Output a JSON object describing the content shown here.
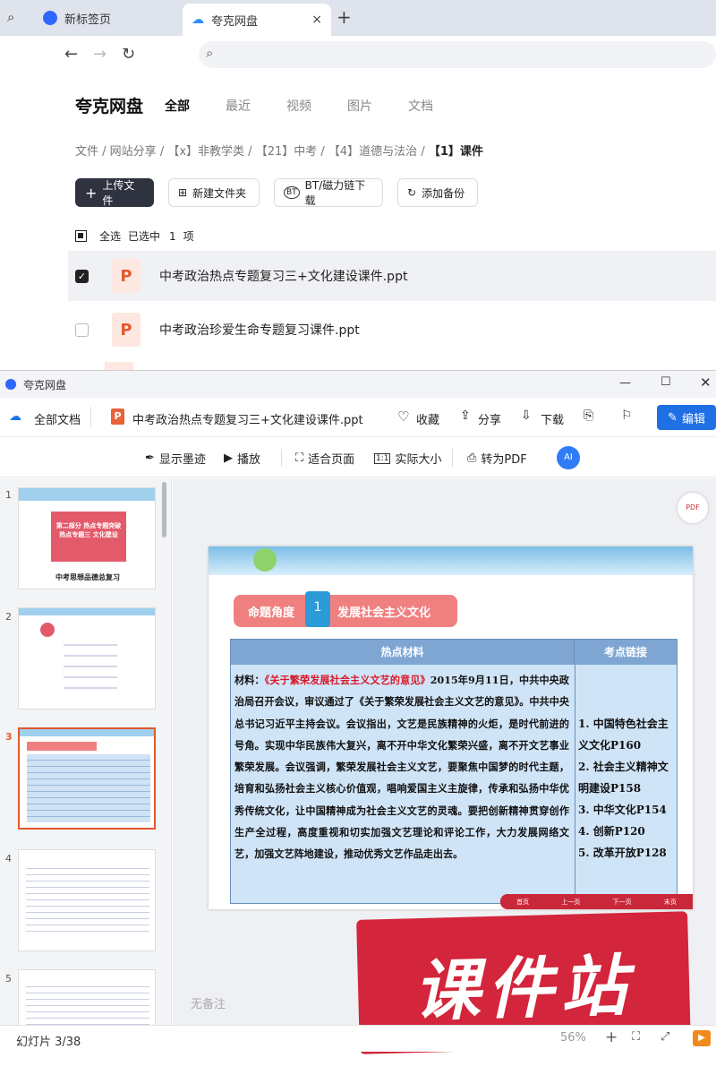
{
  "browser": {
    "tabs": [
      {
        "label": "新标签页"
      },
      {
        "label": "夸克网盘"
      }
    ],
    "new_tab": "+",
    "close": "×"
  },
  "pan": {
    "logo": "夸克网盘",
    "tabs": [
      "全部",
      "最近",
      "视频",
      "图片",
      "文档"
    ],
    "breadcrumb": [
      "文件",
      "网站分享",
      "【x】非教学类",
      "【21】中考",
      "【4】道德与法治",
      "【1】课件"
    ],
    "actions": {
      "upload": "上传文件",
      "new_folder": "新建文件夹",
      "bt": "BT/磁力链下载",
      "backup": "添加备份"
    },
    "selection": {
      "select_all": "全选",
      "selected_prefix": "已选中",
      "count": "1",
      "unit": "项"
    },
    "files": [
      {
        "name": "中考政治热点专题复习三+文化建设课件.ppt",
        "selected": true
      },
      {
        "name": "中考政治珍爱生命专题复习课件.ppt",
        "selected": false
      }
    ]
  },
  "viewer": {
    "window_title": "夸克网盘",
    "all_docs": "全部文档",
    "file_title": "中考政治热点专题复习三+文化建设课件.ppt",
    "actions": {
      "fav": "收藏",
      "share": "分享",
      "download": "下载",
      "edit": "编辑"
    },
    "tools": {
      "ink": "显示墨迹",
      "play": "播放",
      "fit": "适合页面",
      "actual": "实际大小",
      "pdf": "转为PDF"
    },
    "thumbs": [
      {
        "num": "1",
        "title": "第二部分 热点专题突破 热点专题三 文化建设",
        "caption": "中考思想品德总复习"
      },
      {
        "num": "2"
      },
      {
        "num": "3"
      },
      {
        "num": "4"
      },
      {
        "num": "5"
      }
    ],
    "slide": {
      "angle_label": "命题角度",
      "angle_num": "1",
      "angle_title": "发展社会主义文化",
      "col1": "热点材料",
      "col2": "考点链接",
      "material_label": "材料：",
      "material_title": "《关于繁荣发展社会主义文艺的意见》",
      "material_text": "2015年9月11日，中共中央政治局召开会议，审议通过了《关于繁荣发展社会主义文艺的意见》。中共中央总书记习近平主持会议。会议指出，文艺是民族精神的火炬，是时代前进的号角。实现中华民族伟大复兴，离不开中华文化繁荣兴盛，离不开文艺事业繁荣发展。会议强调，繁荣发展社会主义文艺，要聚焦中国梦的时代主题，培育和弘扬社会主义核心价值观，唱响爱国主义主旋律，传承和弘扬中华优秀传统文化，让中国精神成为社会主义文艺的灵魂。要把创新精神贯穿创作生产全过程，高度重视和切实加强文艺理论和评论工作，大力发展网络文艺，加强文艺阵地建设，推动优秀文艺作品走出去。",
      "links": [
        "1. 中国特色社会主义文化P160",
        "2. 社会主义精神文　明建设P158",
        "3. 中华文化P154",
        "4. 创新P120",
        "5. 改革开放P128"
      ],
      "nav": [
        "首页",
        "上一页",
        "下一页",
        "末页"
      ]
    },
    "notes": "无备注",
    "status": "幻灯片 3/38",
    "zoom": "56%",
    "watermark": "课件站"
  }
}
